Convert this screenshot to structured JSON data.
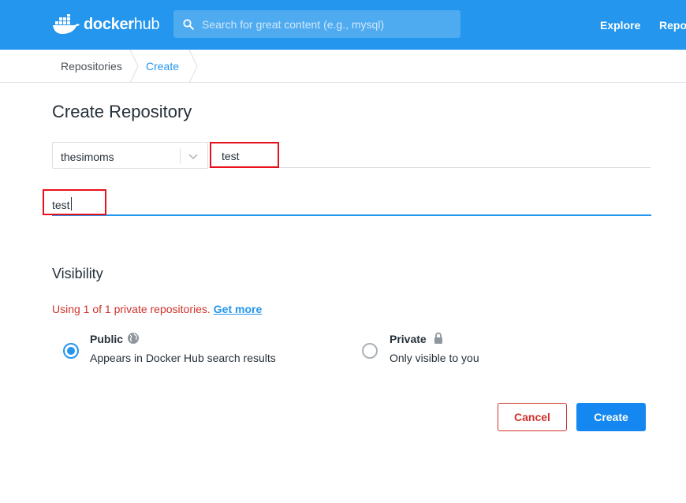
{
  "header": {
    "logo_word1": "docker",
    "logo_word2": "hub",
    "search_placeholder": "Search for great content (e.g., mysql)",
    "nav": {
      "explore": "Explore",
      "repositories": "Repo"
    }
  },
  "breadcrumb": {
    "items": [
      "Repositories",
      "Create"
    ]
  },
  "page": {
    "title": "Create Repository"
  },
  "form": {
    "namespace_value": "thesimoms",
    "name_value": "test",
    "description_value": "test"
  },
  "visibility": {
    "title": "Visibility",
    "note": "Using 1 of 1 private repositories.",
    "note_link": "Get more",
    "options": [
      {
        "title": "Public",
        "desc": "Appears in Docker Hub search results",
        "selected": true,
        "icon": "globe-icon"
      },
      {
        "title": "Private",
        "desc": "Only visible to you",
        "selected": false,
        "icon": "lock-icon"
      }
    ]
  },
  "actions": {
    "cancel": "Cancel",
    "create": "Create"
  },
  "colors": {
    "brand": "#2496ed",
    "danger": "#d0322b",
    "primary_button": "#1488f0",
    "highlight": "#e8101a"
  }
}
